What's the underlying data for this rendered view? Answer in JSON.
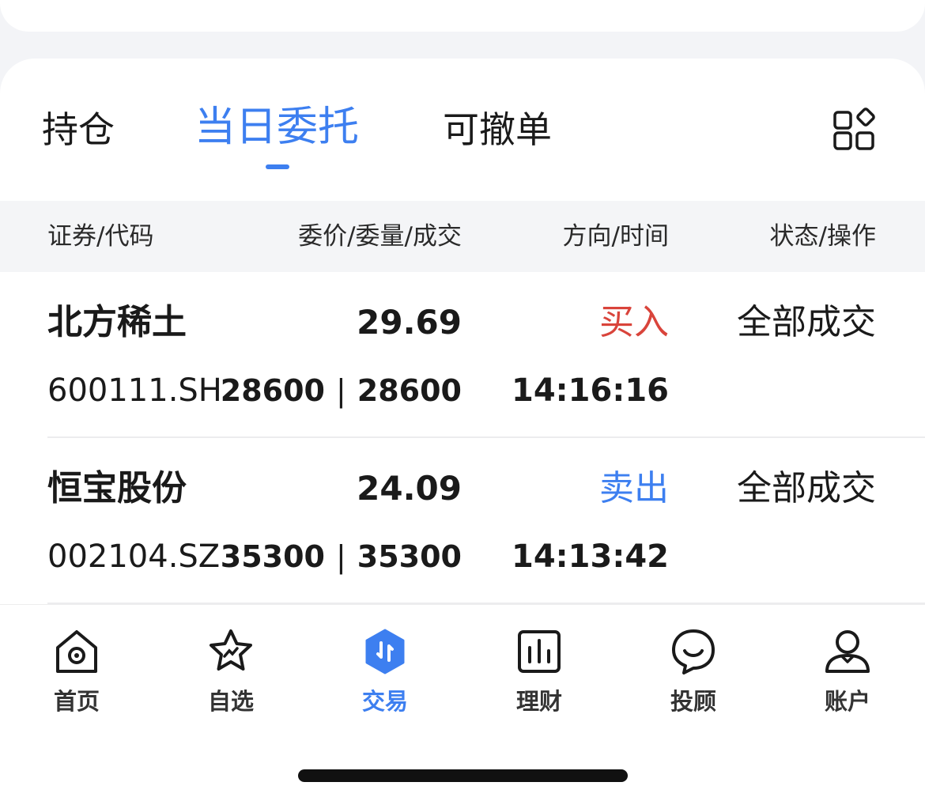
{
  "tabs": [
    {
      "label": "持仓",
      "active": false
    },
    {
      "label": "当日委托",
      "active": true
    },
    {
      "label": "可撤单",
      "active": false
    }
  ],
  "table": {
    "headers": [
      "证券/代码",
      "委价/委量/成交",
      "方向/时间",
      "状态/操作"
    ]
  },
  "orders": [
    {
      "name": "北方稀土",
      "code": "600111.SH",
      "price": "29.69",
      "quantity": "28600",
      "filled": "28600",
      "direction": "买入",
      "direction_color": "#d9443b",
      "time": "14:16:16",
      "status": "全部成交"
    },
    {
      "name": "恒宝股份",
      "code": "002104.SZ",
      "price": "24.09",
      "quantity": "35300",
      "filled": "35300",
      "direction": "卖出",
      "direction_color": "#3d7ff0",
      "time": "14:13:42",
      "status": "全部成交"
    }
  ],
  "nav": [
    {
      "label": "首页",
      "icon": "home-icon"
    },
    {
      "label": "自选",
      "icon": "star-icon"
    },
    {
      "label": "交易",
      "icon": "trade-icon",
      "active": true
    },
    {
      "label": "理财",
      "icon": "chart-icon"
    },
    {
      "label": "投顾",
      "icon": "advisor-icon"
    },
    {
      "label": "账户",
      "icon": "user-icon"
    }
  ],
  "colors": {
    "accent": "#3d7ff0",
    "buy": "#d9443b",
    "sell": "#3d7ff0"
  }
}
